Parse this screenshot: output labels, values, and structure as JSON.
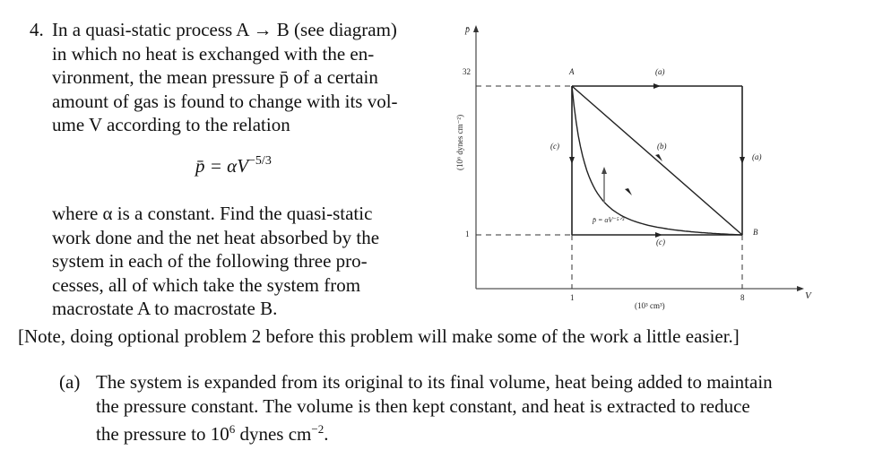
{
  "problem": {
    "number": "4.",
    "intro_lines": [
      "In a quasi-static process A → B (see diagram)",
      "in which no heat is exchanged with the en-",
      "vironment, the mean pressure p̄ of a certain",
      "amount of gas is found to change with its vol-",
      "ume V according to the relation"
    ],
    "equation": {
      "lhs": "p̄ = αV",
      "exponent": "−5/3"
    },
    "body_lines": [
      "where α is a constant.  Find the quasi-static",
      "work done and the net heat absorbed by the",
      "system in each of the following three pro-",
      "cesses, all of which take the system from",
      "macrostate A to macrostate B."
    ],
    "note": "[Note, doing optional problem 2 before this problem will make some of the work a little easier.]",
    "part_a": {
      "label": "(a)",
      "lines": [
        "The system is expanded from its original to its final volume, heat being added to maintain",
        "the pressure constant.  The volume is then kept constant, and heat is extracted to reduce"
      ],
      "last_line_prefix": "the pressure to 10",
      "last_line_exp": "6",
      "last_line_mid": " dynes cm",
      "last_line_exp2": "−2",
      "last_line_suffix": "."
    }
  },
  "diagram": {
    "y_axis_symbol": "p̄",
    "y_axis_unit": "(10⁶ dynes cm⁻²)",
    "x_axis_symbol": "V",
    "x_axis_unit": "(10³ cm³)",
    "y_ticks": [
      "32",
      "1"
    ],
    "x_ticks": [
      "1",
      "8"
    ],
    "point_A": "A",
    "point_B": "B",
    "path_labels": {
      "a_top": "(a)",
      "a_right": "(a)",
      "b": "(b)",
      "c_left": "(c)",
      "c_bottom": "(c)"
    },
    "curve_label": "p̄ = αV⁻⁵ᐟ³",
    "points": {
      "A": {
        "V": 1,
        "p": 32
      },
      "B": {
        "V": 8,
        "p": 1
      }
    }
  }
}
